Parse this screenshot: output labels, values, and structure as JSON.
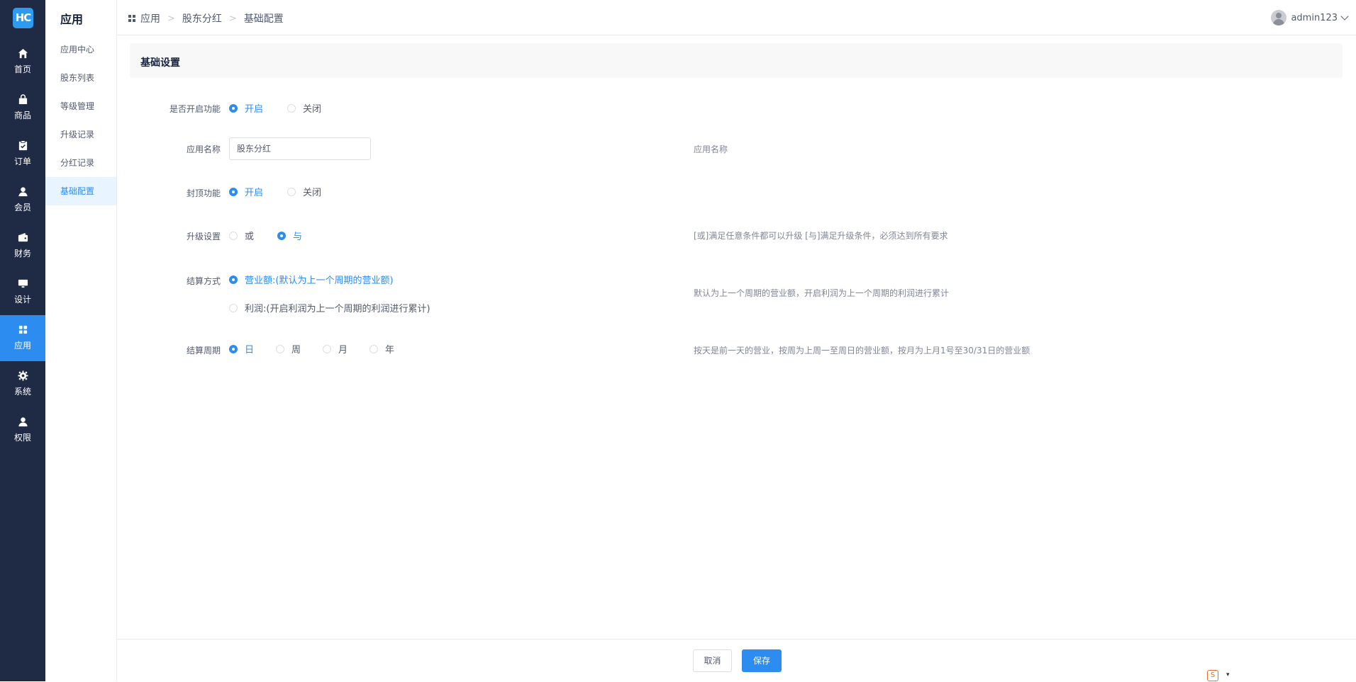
{
  "rail": {
    "logo": "HC",
    "items": [
      {
        "label": "首页",
        "icon": "home-icon"
      },
      {
        "label": "商品",
        "icon": "bag-icon"
      },
      {
        "label": "订单",
        "icon": "clipboard-icon"
      },
      {
        "label": "会员",
        "icon": "user-icon"
      },
      {
        "label": "财务",
        "icon": "wallet-icon"
      },
      {
        "label": "设计",
        "icon": "monitor-icon"
      },
      {
        "label": "应用",
        "icon": "apps-icon",
        "active": true
      },
      {
        "label": "系统",
        "icon": "gear-icon"
      },
      {
        "label": "权限",
        "icon": "person-icon"
      }
    ]
  },
  "sidebar": {
    "title": "应用",
    "items": [
      {
        "label": "应用中心"
      },
      {
        "label": "股东列表"
      },
      {
        "label": "等级管理"
      },
      {
        "label": "升级记录"
      },
      {
        "label": "分红记录"
      },
      {
        "label": "基础配置",
        "active": true
      }
    ]
  },
  "breadcrumb": [
    "应用",
    "股东分红",
    "基础配置"
  ],
  "user": {
    "name": "admin123"
  },
  "section": {
    "title": "基础设置"
  },
  "form": {
    "enable": {
      "label": "是否开启功能",
      "options": [
        "开启",
        "关闭"
      ],
      "selected": "开启"
    },
    "app_name": {
      "label": "应用名称",
      "value": "股东分红",
      "hint": "应用名称"
    },
    "cap": {
      "label": "封顶功能",
      "options": [
        "开启",
        "关闭"
      ],
      "selected": "开启"
    },
    "upgrade": {
      "label": "升级设置",
      "options": [
        "或",
        "与"
      ],
      "selected": "与",
      "hint": "[或]满足任意条件都可以升级 [与]满足升级条件，必须达到所有要求"
    },
    "settle_method": {
      "label": "结算方式",
      "options": [
        "营业额:(默认为上一个周期的营业额)",
        "利润:(开启利润为上一个周期的利润进行累计)"
      ],
      "selected": "营业额:(默认为上一个周期的营业额)",
      "hint": "默认为上一个周期的营业额，开启利润为上一个周期的利润进行累计"
    },
    "settle_cycle": {
      "label": "结算周期",
      "options": [
        "日",
        "周",
        "月",
        "年"
      ],
      "selected": "日",
      "hint": "按天是前一天的营业，按周为上周一至周日的营业额，按月为上月1号至30/31日的营业额"
    }
  },
  "footer": {
    "cancel": "取消",
    "save": "保存"
  },
  "colors": {
    "accent": "#2d8cf0",
    "rail": "#1f2a44"
  }
}
